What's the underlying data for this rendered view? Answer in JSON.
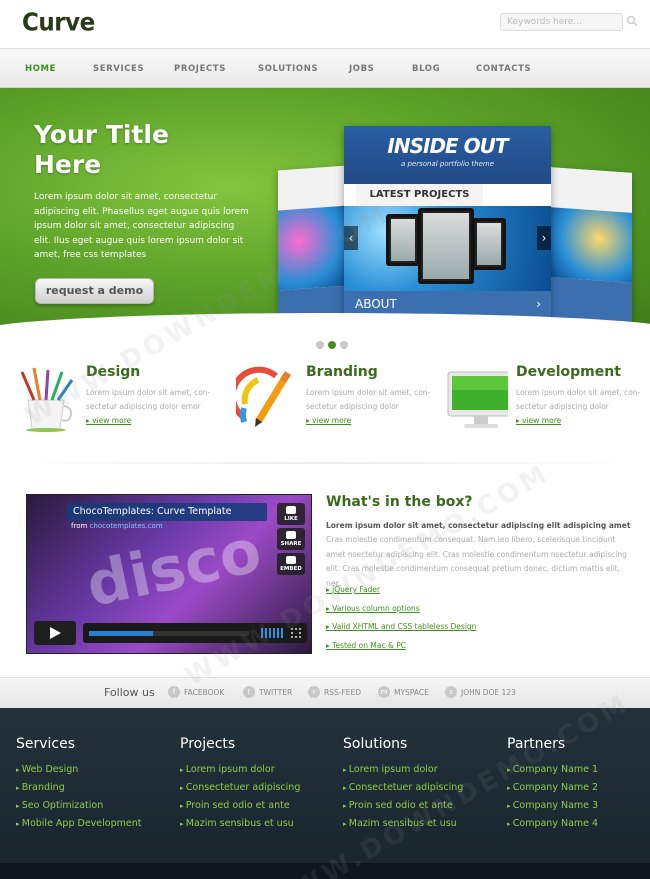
{
  "header": {
    "logo": "Curve",
    "search_placeholder": "Keywords here..."
  },
  "nav": {
    "items": [
      "HOME",
      "SERVICES",
      "PROJECTS",
      "SOLUTIONS",
      "JOBS",
      "BLOG",
      "CONTACTS"
    ],
    "active": "HOME"
  },
  "hero": {
    "title": "Your Title Here",
    "text": "Lorem ipsum dolor sit amet, consectetur adipiscing elit. Phasellus eget augue quis lorem ipsum dolor sit amet, consectetur adipiscing elit. Ilus eget augue quis lorem ipsum dolor sit amet, free css templates",
    "button_label": "request a demo",
    "slide": {
      "brand": "INSIDE OUT",
      "tagline": "a personal portfolio theme",
      "latest_label": "LATEST PROJECTS",
      "about_label": "ABOUT",
      "arrow_left": "‹",
      "arrow_right": "›"
    },
    "dots": 3,
    "active_dot": 2
  },
  "features": [
    {
      "title": "Design",
      "text": "Lorem ipsum dolor sit amet, con-sectetur adipiscing dolor emor",
      "link": "view more",
      "icon": "paint-brushes-icon"
    },
    {
      "title": "Branding",
      "text": "Lorem ipsum dolor sit amet, con-sectetur adipiscing dolor",
      "link": "view more",
      "icon": "pencil-color-wheel-icon"
    },
    {
      "title": "Development",
      "text": "Lorem ipsum dolor sit amet, con-sectetur adipiscing dolor",
      "link": "view more",
      "icon": "monitor-icon"
    }
  ],
  "video": {
    "title": "ChocoTemplates: Curve Template",
    "from_label": "from",
    "from_source": "chocotemplates.com",
    "buttons": [
      "LIKE",
      "SHARE",
      "EMBED"
    ]
  },
  "box": {
    "title": "What's in the box?",
    "lead": "Lorem ipsum dolor sit amet, consectetur adipiscing elit adispicing amet",
    "text": "Cras molestie condimentum consequat. Nam leo libero, scelerisque tincidunt amet nsectetur adipiscing elit. Cras molestie condimentum nsectetur adipiscing elit. Cras molestie condimentum consequat pretium donec, dictum mattis elit, nec.",
    "links": [
      "jQuery Fader",
      "Various column options",
      "Valid XHTML and CSS tableless Design",
      "Tested on Mac & PC"
    ]
  },
  "follow": {
    "label": "Follow us",
    "items": [
      "FACEBOOK",
      "TWITTER",
      "RSS-FEED",
      "MYSPACE",
      "JOHN DOE 123"
    ]
  },
  "footer": {
    "columns": [
      {
        "title": "Services",
        "links": [
          "Web Design",
          "Branding",
          "Seo Optimization",
          "Mobile App Development"
        ]
      },
      {
        "title": "Projects",
        "links": [
          "Lorem ipsum dolor",
          "Consectetuer adipiscing",
          "Proin sed odio et ante",
          "Mazim sensibus et usu"
        ]
      },
      {
        "title": "Solutions",
        "links": [
          "Lorem ipsum dolor",
          "Consectetuer adipiscing",
          "Proin sed odio et ante",
          "Mazim sensibus et usu"
        ]
      },
      {
        "title": "Partners",
        "links": [
          "Company Name 1",
          "Company Name 2",
          "Company Name 3",
          "Company Name 4"
        ]
      }
    ]
  },
  "watermark": "WWW.DOWNDEMO.COM",
  "colors": {
    "accent_green": "#3f8f1c",
    "hero_green": "#5ea42a",
    "footer_bg": "#22313b",
    "footer_link": "#8ccd4a"
  }
}
